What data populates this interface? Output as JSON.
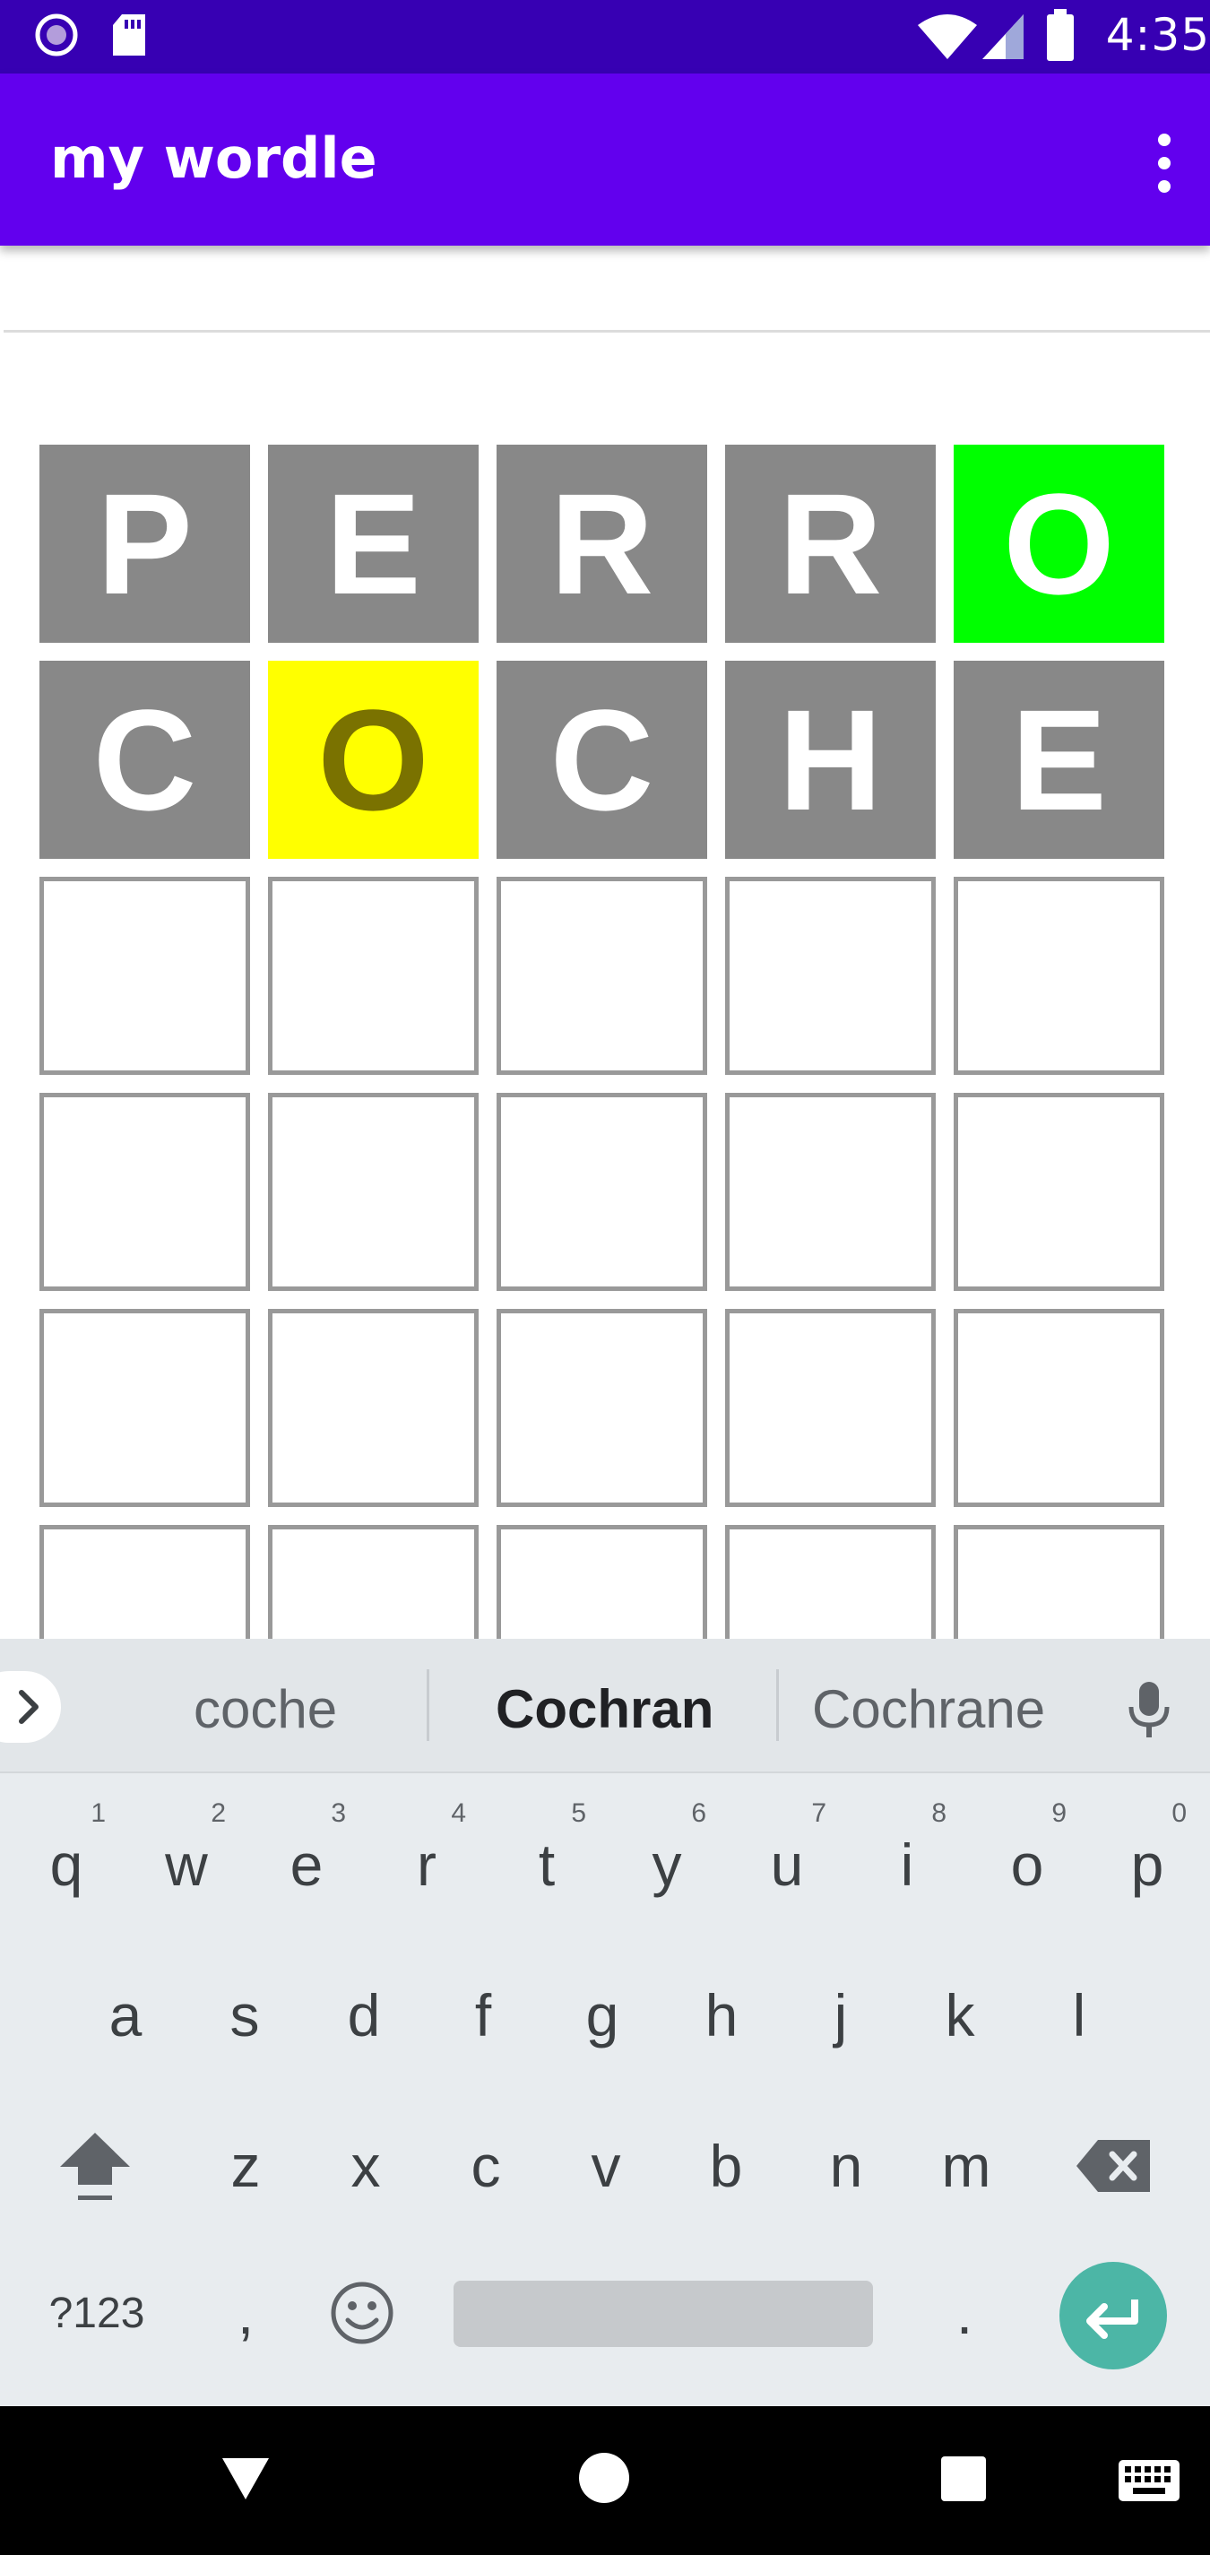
{
  "status_bar": {
    "time": "4:35"
  },
  "app_bar": {
    "title": "my wordle"
  },
  "grid": {
    "rows": [
      [
        {
          "letter": "P",
          "state": "gray"
        },
        {
          "letter": "E",
          "state": "gray"
        },
        {
          "letter": "R",
          "state": "gray"
        },
        {
          "letter": "R",
          "state": "gray"
        },
        {
          "letter": "O",
          "state": "green"
        }
      ],
      [
        {
          "letter": "C",
          "state": "gray"
        },
        {
          "letter": "O",
          "state": "yellow"
        },
        {
          "letter": "C",
          "state": "gray"
        },
        {
          "letter": "H",
          "state": "gray"
        },
        {
          "letter": "E",
          "state": "gray"
        }
      ],
      [
        {
          "letter": "",
          "state": "empty"
        },
        {
          "letter": "",
          "state": "empty"
        },
        {
          "letter": "",
          "state": "empty"
        },
        {
          "letter": "",
          "state": "empty"
        },
        {
          "letter": "",
          "state": "empty"
        }
      ],
      [
        {
          "letter": "",
          "state": "empty"
        },
        {
          "letter": "",
          "state": "empty"
        },
        {
          "letter": "",
          "state": "empty"
        },
        {
          "letter": "",
          "state": "empty"
        },
        {
          "letter": "",
          "state": "empty"
        }
      ],
      [
        {
          "letter": "",
          "state": "empty"
        },
        {
          "letter": "",
          "state": "empty"
        },
        {
          "letter": "",
          "state": "empty"
        },
        {
          "letter": "",
          "state": "empty"
        },
        {
          "letter": "",
          "state": "empty"
        }
      ],
      [
        {
          "letter": "",
          "state": "empty"
        },
        {
          "letter": "",
          "state": "empty"
        },
        {
          "letter": "",
          "state": "empty"
        },
        {
          "letter": "",
          "state": "empty"
        },
        {
          "letter": "",
          "state": "empty"
        }
      ]
    ]
  },
  "keyboard": {
    "suggestions": [
      "coche",
      "Cochran",
      "Cochrane"
    ],
    "row1": [
      {
        "k": "q",
        "h": "1"
      },
      {
        "k": "w",
        "h": "2"
      },
      {
        "k": "e",
        "h": "3"
      },
      {
        "k": "r",
        "h": "4"
      },
      {
        "k": "t",
        "h": "5"
      },
      {
        "k": "y",
        "h": "6"
      },
      {
        "k": "u",
        "h": "7"
      },
      {
        "k": "i",
        "h": "8"
      },
      {
        "k": "o",
        "h": "9"
      },
      {
        "k": "p",
        "h": "0"
      }
    ],
    "row2": [
      "a",
      "s",
      "d",
      "f",
      "g",
      "h",
      "j",
      "k",
      "l"
    ],
    "row3": [
      "z",
      "x",
      "c",
      "v",
      "b",
      "n",
      "m"
    ],
    "symbols_key": "?123",
    "comma_key": ",",
    "period_key": "."
  },
  "colors": {
    "status_bar": "#3700b3",
    "app_bar": "#6200ee",
    "tile_gray": "#888888",
    "tile_green": "#00ff00",
    "tile_yellow": "#ffff00",
    "enter_key": "#4cb6a6"
  },
  "icons": {
    "status_left": [
      "cast-icon",
      "sd-card-icon"
    ],
    "status_right": [
      "wifi-icon",
      "signal-icon",
      "battery-icon"
    ],
    "app_bar": [
      "more-vert-icon"
    ],
    "keyboard": [
      "expand-suggestions-icon",
      "mic-icon",
      "shift-icon",
      "backspace-icon",
      "emoji-icon",
      "enter-icon"
    ],
    "nav": [
      "back-icon",
      "home-icon",
      "recents-icon",
      "keyboard-switch-icon"
    ]
  }
}
